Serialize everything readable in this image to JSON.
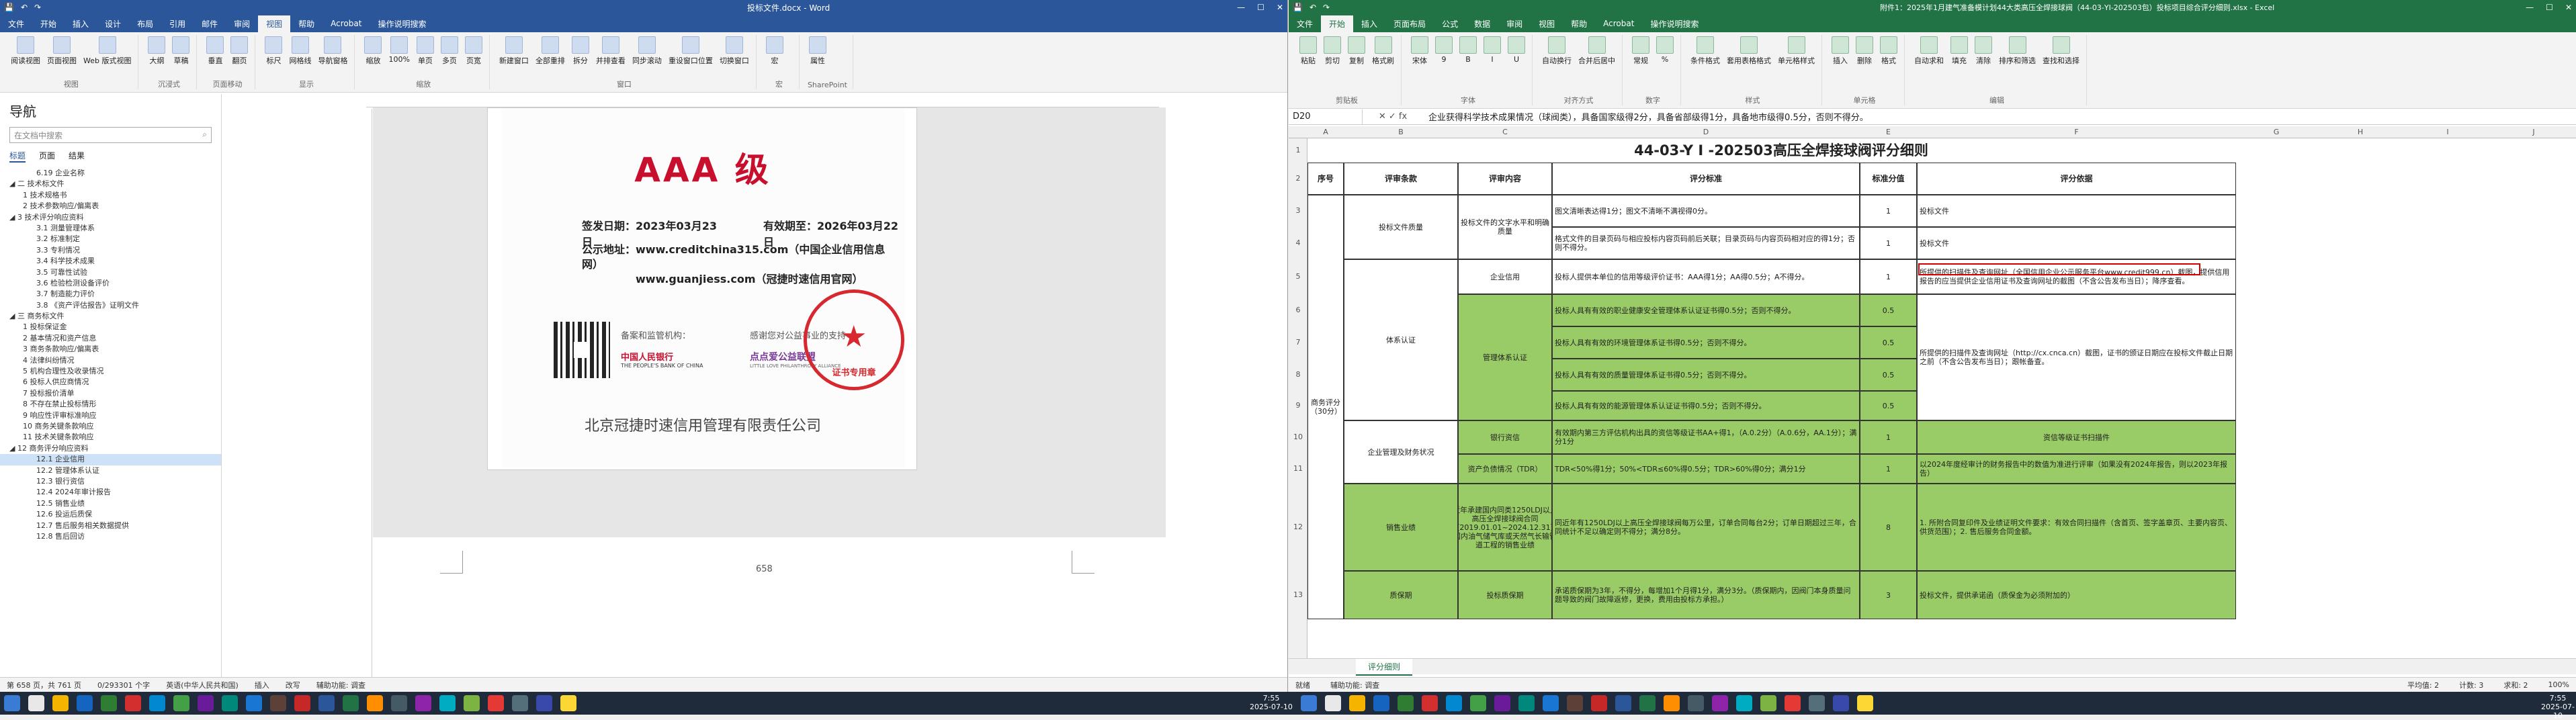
{
  "word": {
    "title": "投标文件.docx - Word",
    "share": "共享",
    "tabs": [
      "文件",
      "开始",
      "插入",
      "设计",
      "布局",
      "引用",
      "邮件",
      "审阅",
      "视图",
      "帮助",
      "Acrobat",
      "操作说明搜索"
    ],
    "active_tab": "视图",
    "ribbon_groups": [
      {
        "label": "视图",
        "items": [
          "阅读视图",
          "页面视图",
          "Web 版式视图"
        ]
      },
      {
        "label": "沉浸式",
        "items": [
          "大纲",
          "草稿"
        ]
      },
      {
        "label": "页面移动",
        "items": [
          "垂直",
          "翻页"
        ]
      },
      {
        "label": "显示",
        "items": [
          "标尺",
          "网格线",
          "导航窗格"
        ]
      },
      {
        "label": "缩放",
        "items": [
          "缩放",
          "100%",
          "单页",
          "多页",
          "页宽"
        ]
      },
      {
        "label": "窗口",
        "items": [
          "新建窗口",
          "全部重排",
          "拆分",
          "并排查看",
          "同步滚动",
          "重设窗口位置",
          "切换窗口"
        ]
      },
      {
        "label": "宏",
        "items": [
          "宏"
        ]
      },
      {
        "label": "SharePoint",
        "items": [
          "属性"
        ]
      }
    ],
    "nav": {
      "title": "导航",
      "search_placeholder": "在文档中搜索",
      "tabs": [
        "标题",
        "页面",
        "结果"
      ],
      "active_tab": "标题",
      "items": [
        "6.19 企业名称",
        "◢ 二 技术标文件",
        "1 技术规格书",
        "2 技术参数响应/偏离表",
        "◢ 3 技术评分响应资料",
        "3.1 测量管理体系",
        "3.2 标准制定",
        "3.3 专利情况",
        "3.4 科学技术成果",
        "3.5 可靠性试验",
        "3.6 检验检测设备评价",
        "3.7 制造能力评价",
        "3.8 《资产评估报告》证明文件",
        "◢ 三 商务标文件",
        "1 投标保证金",
        "2 基本情况和资产信息",
        "3 商务条款响应/偏离表",
        "4 法律纠纷情况",
        "5 机构合理性及收录情况",
        "6 投标人供应商情况",
        "7 投标报价清单",
        "8 不存在禁止投标情形",
        "9 响应性评审标准响应",
        "10 商务关键条款响应",
        "11 技术关键条款响应",
        "◢ 12 商务评分响应资料",
        "12.1 企业信用",
        "12.2 管理体系认证",
        "12.3 银行资信",
        "12.4 2024年审计报告",
        "12.5 销售业绩",
        "12.6 投运后质保",
        "12.7 售后服务相关数据提供",
        "12.8 售后回访"
      ],
      "selected_index": 26
    },
    "certificate": {
      "grade": "AAA 级",
      "issue_date": "签发日期：2023年03月23日",
      "valid_until": "有效期至：2026年03月22日",
      "query_label": "公示地址：",
      "query_line1": "www.creditchina315.com（中国企业信用信息网）",
      "query_line2": "www.guanjiess.com（冠捷时速信用官网）",
      "regulator_label": "备案和监管机构：",
      "supporter_label": "感谢您对公益事业的支持",
      "pboc": "中国人民银行",
      "pboc_en": "THE PEOPLE'S BANK OF CHINA",
      "lpa": "点点爱公益联盟",
      "lpa_en": "LITTLE LOVE PHILANTHROPY ALLIANCE",
      "seal_text": "证书专用章",
      "company": "北京冠捷时速信用管理有限责任公司"
    },
    "page_marker": "658",
    "status": {
      "page": "第 658 页，共 761 页",
      "words": "0/293301 个字",
      "language": "英语(中华人民共和国)",
      "edit": "插入",
      "ime": "改写",
      "accessibility": "辅助功能: 调查"
    }
  },
  "excel": {
    "title": "附件1：2025年1月建气准备模计划44大类高压全焊接球阀（44-03-YI-202503包）投标项目综合评分细则.xlsx - Excel",
    "share": "共享",
    "tabs": [
      "文件",
      "开始",
      "插入",
      "页面布局",
      "公式",
      "数据",
      "审阅",
      "视图",
      "帮助",
      "Acrobat",
      "操作说明搜索"
    ],
    "active_tab": "开始",
    "ribbon_groups": [
      {
        "label": "剪贴板",
        "items": [
          "粘贴",
          "剪切",
          "复制",
          "格式刷"
        ]
      },
      {
        "label": "字体",
        "items": [
          "宋体",
          "9",
          "B",
          "I",
          "U"
        ]
      },
      {
        "label": "对齐方式",
        "items": [
          "自动换行",
          "合并后居中"
        ]
      },
      {
        "label": "数字",
        "items": [
          "常规",
          "%"
        ]
      },
      {
        "label": "样式",
        "items": [
          "条件格式",
          "套用表格格式",
          "单元格样式"
        ]
      },
      {
        "label": "单元格",
        "items": [
          "插入",
          "删除",
          "格式"
        ]
      },
      {
        "label": "编辑",
        "items": [
          "自动求和",
          "填充",
          "清除",
          "排序和筛选",
          "查找和选择"
        ]
      }
    ],
    "name_box": "D20",
    "formula": "企业获得科学技术成果情况（球阀类），具备国家级得2分，具备省部级得1分，具备地市级得0.5分，否则不得分。",
    "columns": [
      "A",
      "B",
      "C",
      "D",
      "E",
      "F",
      "G",
      "H",
      "I",
      "J"
    ],
    "rows": [
      "1",
      "2",
      "3",
      "4",
      "5",
      "6",
      "7",
      "8",
      "9",
      "10",
      "11",
      "12",
      "13"
    ],
    "sheet_title": "44-03-Y I -202503高压全焊接球阀评分细则",
    "headers": [
      "序号",
      "评审条款",
      "评审内容",
      "评分标准",
      "标准分值",
      "评分依据"
    ],
    "cells": {
      "b3": "投标文件质量",
      "c3": "投标文件的文字水平和明确质量",
      "d3": "图文清晰表达得1分；图文不清晰不满视得0分。",
      "e3": "1",
      "f3": "投标文件",
      "d4": "格式文件的目录页码与相应投标内容页码前后关联；目录页码与内容页码相对应的得1分；否则不得分。",
      "e4": "1",
      "f4": "投标文件",
      "c5": "企业信用",
      "d5": "投标人提供本单位的信用等级评价证书：AAA得1分；AA得0.5分；A不得分。",
      "e5": "1",
      "f5": "所提供的扫描件及查询网址（全国信用企业公示服务平台www.credit999.cn）截图，提供信用报告的应当提供企业信用证书及查询网址的截图（不含公告发布当日）；降序查看。",
      "b6": "体系认证",
      "c6": "管理体系认证",
      "d6": "投标人具有有效的职业健康安全管理体系认证证书得0.5分；否则不得分。",
      "e6": "0.5",
      "d7": "投标人具有有效的环境管理体系证书得0.5分；否则不得分。",
      "e7": "0.5",
      "d8": "投标人具有有效的质量管理体系证书得0.5分；否则不得分。",
      "e8": "0.5",
      "d9": "投标人具有有效的能源管理体系认证证书得0.5分；否则不得分。",
      "e9": "0.5",
      "f6": "所提供的扫描件及查询网址（http://cx.cnca.cn）截图，证书的颁证日期应在投标文件截止日期之前（不含公告发布当日）；跟帐备查。",
      "b10": "企业管理及财务状况",
      "c10": "银行资信",
      "d10": "有效期内第三方评估机构出具的资信等级证书AA+得1，（A.0.2分）（A.0.6分，AA.1分）；满分1分",
      "e10": "1",
      "f10": "资信等级证书扫描件",
      "c11": "资产负债情况（TDR）",
      "d11": "TDR<50%得1分；50%<TDR≤60%得0.5分；TDR>60%得0分；满分1分",
      "e11": "1",
      "f11": "以2024年度经审计的财务报告中的数值为准进行评审（如果没有2024年报告，则以2023年报告）",
      "a10": "商务评分（30分）",
      "b12": "销售业绩",
      "c12": "近年承建国内同类1250LDJ以上高压全焊接球阀合同（2019.01.01~2024.12.31）国内油气储气库或天然气长输管道工程的销售业绩",
      "d12": "同近年有1250LDJ以上高压全焊接球阀每万公里，订单合同每台2分；订单日期超过三年，合同统计不足以确定则不得分；满分8分。",
      "e12": "8",
      "f12": "1. 所附合同复印件及业绩证明文件要求：有效合同扫描件（含首页、签字盖章页、主要内容页、供货范围）；2. 售后服务合同金额。",
      "b13": "质保期",
      "c13": "投标质保期",
      "d13": "承诺质保期为3年，不得分，每增加1个月得1分，满分3分。（质保期内，因阀门本身质量问题导致的阀门故障返修，更换，费用由投标方承担。）",
      "e13": "3",
      "f13": "投标文件，提供承诺函（质保金为必须附加的）"
    },
    "sheet_tab": "评分细则",
    "status": {
      "ready": "就绪",
      "accessibility": "辅助功能: 调查",
      "avg": "平均值: 2",
      "count": "计数: 3",
      "sum": "求和: 2",
      "zoom": "100%"
    }
  },
  "taskbar": {
    "time1": "7:55",
    "date1": "2025-07-10",
    "time2": "7:55",
    "date2": "2025-07-10"
  },
  "colors": {
    "word_accent": "#2b579a",
    "excel_accent": "#217346",
    "green_fill": "#99cc66",
    "seal_red": "#d6282e"
  }
}
